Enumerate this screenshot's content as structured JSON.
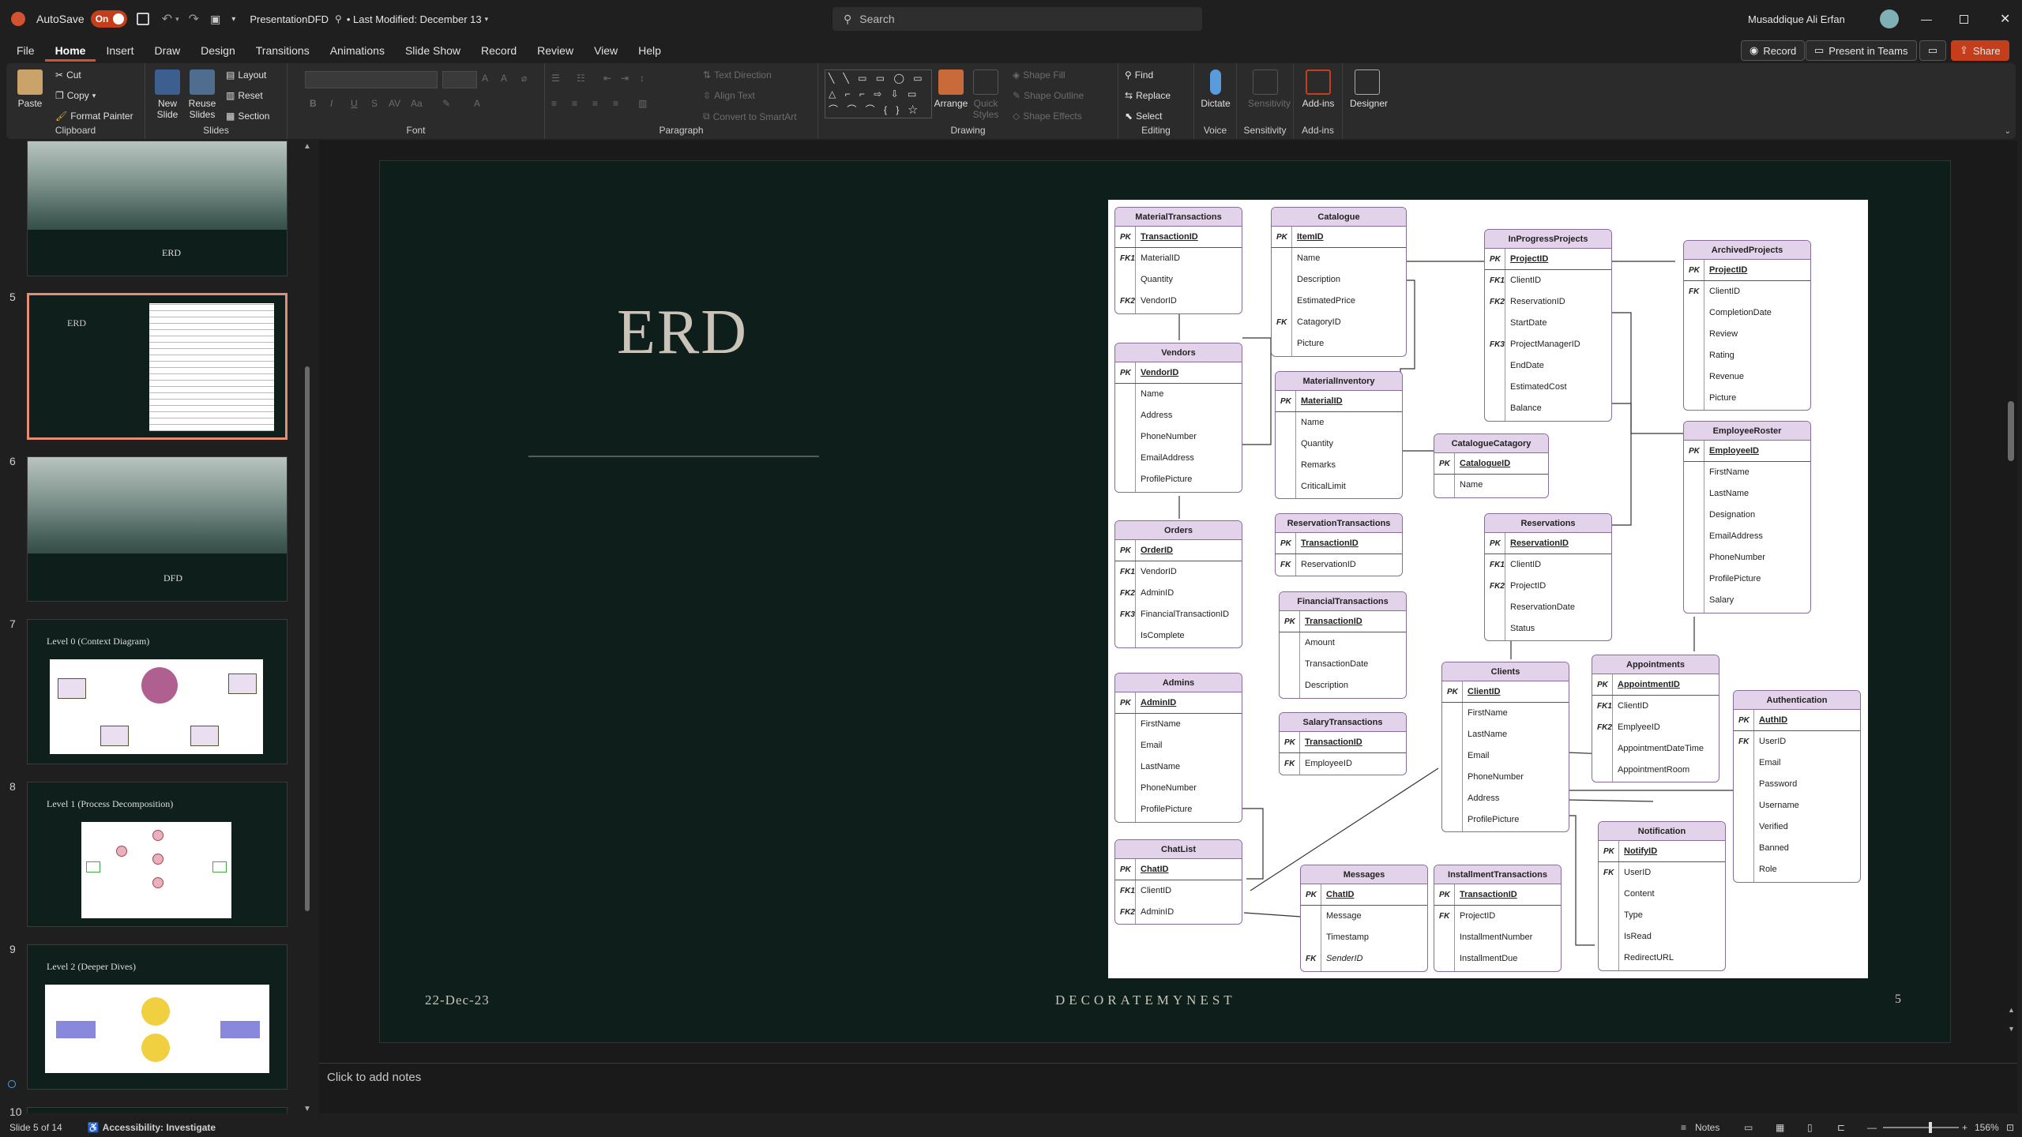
{
  "titlebar": {
    "autosave_label": "AutoSave",
    "autosave_state": "On",
    "filename": "PresentationDFD",
    "modified": "• Last Modified: December 13",
    "search_placeholder": "Search",
    "user": "Musaddique Ali Erfan"
  },
  "menu": {
    "tabs": [
      "File",
      "Home",
      "Insert",
      "Draw",
      "Design",
      "Transitions",
      "Animations",
      "Slide Show",
      "Record",
      "Review",
      "View",
      "Help"
    ],
    "record_btn": "Record",
    "present_btn": "Present in Teams",
    "share_btn": "Share"
  },
  "ribbon": {
    "clipboard": {
      "label": "Clipboard",
      "paste": "Paste",
      "cut": "Cut",
      "copy": "Copy",
      "format_painter": "Format Painter"
    },
    "slides": {
      "label": "Slides",
      "new_slide": "New Slide",
      "reuse": "Reuse Slides",
      "layout": "Layout",
      "reset": "Reset",
      "section": "Section"
    },
    "font": {
      "label": "Font"
    },
    "paragraph": {
      "label": "Paragraph",
      "text_direction": "Text Direction",
      "align_text": "Align Text",
      "convert": "Convert to SmartArt"
    },
    "drawing": {
      "label": "Drawing",
      "arrange": "Arrange",
      "quick_styles": "Quick Styles",
      "shape_fill": "Shape Fill",
      "shape_outline": "Shape Outline",
      "shape_effects": "Shape Effects"
    },
    "editing": {
      "label": "Editing",
      "find": "Find",
      "replace": "Replace",
      "select": "Select"
    },
    "voice": {
      "label": "Voice",
      "dictate": "Dictate"
    },
    "sensitivity": {
      "label": "Sensitivity",
      "btn": "Sensitivity"
    },
    "addins": {
      "label": "Add-ins",
      "btn": "Add-ins"
    },
    "designer": {
      "btn": "Designer"
    }
  },
  "thumbnails": [
    {
      "num": "",
      "title": "ERD",
      "kind": "forest"
    },
    {
      "num": "5",
      "title": "ERD",
      "kind": "erd"
    },
    {
      "num": "6",
      "title": "DFD",
      "kind": "forest"
    },
    {
      "num": "7",
      "title": "Level 0 (Context Diagram)",
      "kind": "diagram"
    },
    {
      "num": "8",
      "title": "Level 1 (Process Decomposition)",
      "kind": "diagram"
    },
    {
      "num": "9",
      "title": "Level 2 (Deeper Dives)",
      "kind": "diagram"
    },
    {
      "num": "10",
      "title": "",
      "kind": "blank"
    }
  ],
  "slide": {
    "title": "ERD",
    "date": "22-Dec-23",
    "footer": "DECORATEMYNEST",
    "page": "5"
  },
  "erd": {
    "entities": [
      {
        "name": "MaterialTransactions",
        "rows": [
          [
            "PK",
            "TransactionID"
          ],
          [
            "FK1",
            "MaterialID"
          ],
          [
            "",
            "Quantity"
          ],
          [
            "FK2",
            "VendorID"
          ]
        ]
      },
      {
        "name": "Vendors",
        "rows": [
          [
            "PK",
            "VendorID"
          ],
          [
            "",
            "Name"
          ],
          [
            "",
            "Address"
          ],
          [
            "",
            "PhoneNumber"
          ],
          [
            "",
            "EmailAddress"
          ],
          [
            "",
            "ProfilePicture"
          ]
        ]
      },
      {
        "name": "Orders",
        "rows": [
          [
            "PK",
            "OrderID"
          ],
          [
            "FK1",
            "VendorID"
          ],
          [
            "FK2",
            "AdminID"
          ],
          [
            "FK3",
            "FinancialTransactionID"
          ],
          [
            "",
            "IsComplete"
          ]
        ]
      },
      {
        "name": "Admins",
        "rows": [
          [
            "PK",
            "AdminID"
          ],
          [
            "",
            "FirstName"
          ],
          [
            "",
            "Email"
          ],
          [
            "",
            "LastName"
          ],
          [
            "",
            "PhoneNumber"
          ],
          [
            "",
            "ProfilePicture"
          ]
        ]
      },
      {
        "name": "ChatList",
        "rows": [
          [
            "PK",
            "ChatID"
          ],
          [
            "FK1",
            "ClientID"
          ],
          [
            "FK2",
            "AdminID"
          ]
        ]
      },
      {
        "name": "Catalogue",
        "rows": [
          [
            "PK",
            "ItemID"
          ],
          [
            "",
            "Name"
          ],
          [
            "",
            "Description"
          ],
          [
            "",
            "EstimatedPrice"
          ],
          [
            "FK",
            "CatagoryID"
          ],
          [
            "",
            "Picture"
          ]
        ]
      },
      {
        "name": "MaterialInventory",
        "rows": [
          [
            "PK",
            "MaterialID"
          ],
          [
            "",
            "Name"
          ],
          [
            "",
            "Quantity"
          ],
          [
            "",
            "Remarks"
          ],
          [
            "",
            "CriticalLimit"
          ]
        ]
      },
      {
        "name": "ReservationTransactions",
        "rows": [
          [
            "PK",
            "TransactionID"
          ],
          [
            "FK",
            "ReservationID"
          ]
        ]
      },
      {
        "name": "FinancialTransactions",
        "rows": [
          [
            "PK",
            "TransactionID"
          ],
          [
            "",
            "Amount"
          ],
          [
            "",
            "TransactionDate"
          ],
          [
            "",
            "Description"
          ]
        ]
      },
      {
        "name": "SalaryTransactions",
        "rows": [
          [
            "PK",
            "TransactionID"
          ],
          [
            "FK",
            "EmployeeID"
          ]
        ]
      },
      {
        "name": "Messages",
        "rows": [
          [
            "PK",
            "ChatID"
          ],
          [
            "",
            "Message"
          ],
          [
            "",
            "Timestamp"
          ],
          [
            "FK",
            "SenderID"
          ]
        ]
      },
      {
        "name": "InProgressProjects",
        "rows": [
          [
            "PK",
            "ProjectID"
          ],
          [
            "FK1",
            "ClientID"
          ],
          [
            "FK2",
            "ReservationID"
          ],
          [
            "",
            "StartDate"
          ],
          [
            "FK3",
            "ProjectManagerID"
          ],
          [
            "",
            "EndDate"
          ],
          [
            "",
            "EstimatedCost"
          ],
          [
            "",
            "Balance"
          ]
        ]
      },
      {
        "name": "CatalogueCatagory",
        "rows": [
          [
            "PK",
            "CatalogueID"
          ],
          [
            "",
            "Name"
          ]
        ]
      },
      {
        "name": "Reservations",
        "rows": [
          [
            "PK",
            "ReservationID"
          ],
          [
            "FK1",
            "ClientID"
          ],
          [
            "FK2",
            "ProjectID"
          ],
          [
            "",
            "ReservationDate"
          ],
          [
            "",
            "Status"
          ]
        ]
      },
      {
        "name": "Clients",
        "rows": [
          [
            "PK",
            "ClientID"
          ],
          [
            "",
            "FirstName"
          ],
          [
            "",
            "LastName"
          ],
          [
            "",
            "Email"
          ],
          [
            "",
            "PhoneNumber"
          ],
          [
            "",
            "Address"
          ],
          [
            "",
            "ProfilePicture"
          ]
        ]
      },
      {
        "name": "InstallmentTransactions",
        "rows": [
          [
            "PK",
            "TransactionID"
          ],
          [
            "FK",
            "ProjectID"
          ],
          [
            "",
            "InstallmentNumber"
          ],
          [
            "",
            "InstallmentDue"
          ]
        ]
      },
      {
        "name": "ArchivedProjects",
        "rows": [
          [
            "PK",
            "ProjectID"
          ],
          [
            "FK",
            "ClientID"
          ],
          [
            "",
            "CompletionDate"
          ],
          [
            "",
            "Review"
          ],
          [
            "",
            "Rating"
          ],
          [
            "",
            "Revenue"
          ],
          [
            "",
            "Picture"
          ]
        ]
      },
      {
        "name": "EmployeeRoster",
        "rows": [
          [
            "PK",
            "EmployeeID"
          ],
          [
            "",
            "FirstName"
          ],
          [
            "",
            "LastName"
          ],
          [
            "",
            "Designation"
          ],
          [
            "",
            "EmailAddress"
          ],
          [
            "",
            "PhoneNumber"
          ],
          [
            "",
            "ProfilePicture"
          ],
          [
            "",
            "Salary"
          ]
        ]
      },
      {
        "name": "Appointments",
        "rows": [
          [
            "PK",
            "AppointmentID"
          ],
          [
            "FK1",
            "ClientID"
          ],
          [
            "FK2",
            "EmplyeeID"
          ],
          [
            "",
            "AppointmentDateTime"
          ],
          [
            "",
            "AppointmentRoom"
          ]
        ]
      },
      {
        "name": "Notification",
        "rows": [
          [
            "PK",
            "NotifyID"
          ],
          [
            "FK",
            "UserID"
          ],
          [
            "",
            "Content"
          ],
          [
            "",
            "Type"
          ],
          [
            "",
            "IsRead"
          ],
          [
            "",
            "RedirectURL"
          ]
        ]
      },
      {
        "name": "Authentication",
        "rows": [
          [
            "PK",
            "AuthID"
          ],
          [
            "FK",
            "UserID"
          ],
          [
            "",
            "Email"
          ],
          [
            "",
            "Password"
          ],
          [
            "",
            "Username"
          ],
          [
            "",
            "Verified"
          ],
          [
            "",
            "Banned"
          ],
          [
            "",
            "Role"
          ]
        ]
      }
    ]
  },
  "notes": {
    "placeholder": "Click to add notes"
  },
  "status": {
    "slide": "Slide 5 of 14",
    "accessibility": "Accessibility: Investigate",
    "notes_btn": "Notes",
    "zoom": "156%"
  },
  "colors": {
    "accent": "#c43e1c",
    "slide_bg": "#0e1e1b",
    "entity_header": "#e3d3ea"
  }
}
